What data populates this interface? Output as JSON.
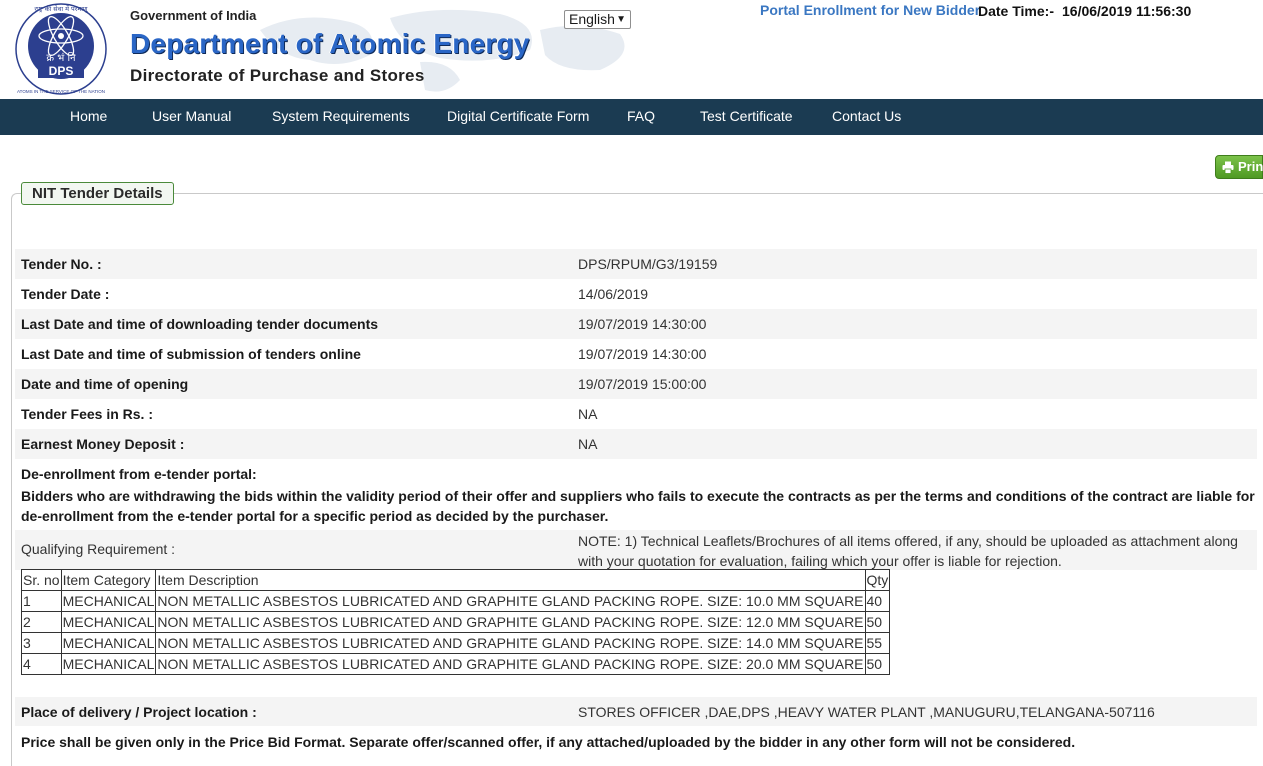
{
  "header": {
    "logo_text_top": "राष्ट्र की सेवा में परमाणु",
    "logo_text_bottom": "ATOMS IN THE SERVICE OF THE NATION",
    "logo_hindi": "क्र भं नि",
    "logo_abbr": "DPS",
    "government": "Government of India",
    "department": "Department of Atomic Energy",
    "directorate": "Directorate of Purchase and Stores",
    "language_selected": "English",
    "portal_link": "Portal Enrollment for New Bidder",
    "datetime_label": "Date Time:-",
    "datetime_value": "16/06/2019 11:56:30"
  },
  "nav": {
    "items": [
      "Home",
      "User Manual",
      "System Requirements",
      "Digital Certificate Form",
      "FAQ",
      "Test Certificate",
      "Contact Us"
    ]
  },
  "print_label": "Print",
  "section_title": "NIT Tender Details",
  "details": [
    {
      "label": "Tender No. :",
      "value": "DPS/RPUM/G3/19159"
    },
    {
      "label": "Tender Date :",
      "value": "14/06/2019"
    },
    {
      "label": "Last Date and time of downloading tender documents",
      "value": "19/07/2019 14:30:00"
    },
    {
      "label": "Last Date and time of submission of tenders online",
      "value": "19/07/2019 14:30:00"
    },
    {
      "label": "Date and time of opening",
      "value": "19/07/2019 15:00:00"
    },
    {
      "label": "Tender Fees in Rs. :",
      "value": "NA"
    },
    {
      "label": "Earnest Money Deposit :",
      "value": "NA"
    }
  ],
  "deenrollment": {
    "title": "De-enrollment from e-tender portal:",
    "text": "Bidders who are withdrawing the bids within the validity period of their offer and suppliers who fails to execute the contracts as per the terms and conditions of the contract are liable for de-enrollment from the e-tender portal for a specific period as decided by the purchaser."
  },
  "qualifying": {
    "label": "Qualifying Requirement :",
    "note": "NOTE: 1) Technical Leaflets/Brochures of all items offered, if any, should be uploaded as attachment along with your quotation for evaluation, failing which your offer is liable for rejection."
  },
  "items_table": {
    "headers": [
      "Sr. no",
      "Item Category",
      "Item Description",
      "Qty"
    ],
    "rows": [
      [
        "1",
        "MECHANICAL",
        "NON METALLIC ASBESTOS LUBRICATED AND GRAPHITE GLAND PACKING ROPE. SIZE: 10.0 MM SQUARE",
        "40"
      ],
      [
        "2",
        "MECHANICAL",
        "NON METALLIC ASBESTOS LUBRICATED AND GRAPHITE GLAND PACKING ROPE. SIZE: 12.0 MM SQUARE",
        "50"
      ],
      [
        "3",
        "MECHANICAL",
        "NON METALLIC ASBESTOS LUBRICATED AND GRAPHITE GLAND PACKING ROPE. SIZE: 14.0 MM SQUARE",
        "55"
      ],
      [
        "4",
        "MECHANICAL",
        "NON METALLIC ASBESTOS LUBRICATED AND GRAPHITE GLAND PACKING ROPE. SIZE: 20.0 MM SQUARE",
        "50"
      ]
    ]
  },
  "delivery": {
    "label": "Place of delivery / Project location :",
    "value": "STORES OFFICER ,DAE,DPS ,HEAVY WATER PLANT ,MANUGURU,TELANGANA-507116"
  },
  "price_note": "Price shall be given only in the Price Bid Format. Separate offer/scanned offer, if any attached/uploaded by the bidder in any other form will not be considered.",
  "colors": {
    "nav_bg": "#1b3b52",
    "accent_blue": "#2a66c6",
    "print_green": "#5ea82e",
    "row_shade": "#f4f4f4"
  }
}
